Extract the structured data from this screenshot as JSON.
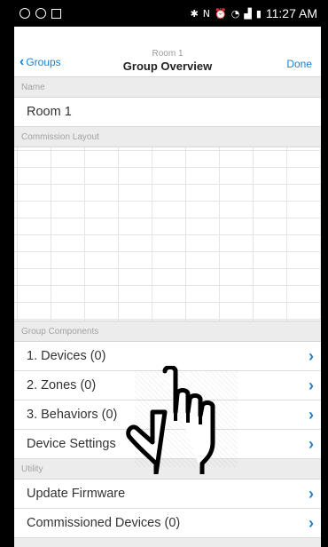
{
  "status_bar": {
    "time": "11:27 AM"
  },
  "nav": {
    "back_label": "Groups",
    "subtitle": "Room 1",
    "title": "Group Overview",
    "done_label": "Done"
  },
  "sections": {
    "name_header": "Name",
    "name_value": "Room 1",
    "layout_header": "Commission Layout",
    "components_header": "Group Components",
    "utility_header": "Utility"
  },
  "components": [
    {
      "label": "1. Devices (0)"
    },
    {
      "label": "2. Zones (0)"
    },
    {
      "label": "3. Behaviors (0)"
    },
    {
      "label": "Device Settings"
    }
  ],
  "utility": [
    {
      "label": "Update Firmware"
    },
    {
      "label": "Commissioned Devices (0)"
    }
  ],
  "colors": {
    "accent": "#1a82d6",
    "section_bg": "#ececec"
  },
  "icons": [
    "back-chevron-icon",
    "row-chevron-icon",
    "pointing-hand-icon"
  ]
}
